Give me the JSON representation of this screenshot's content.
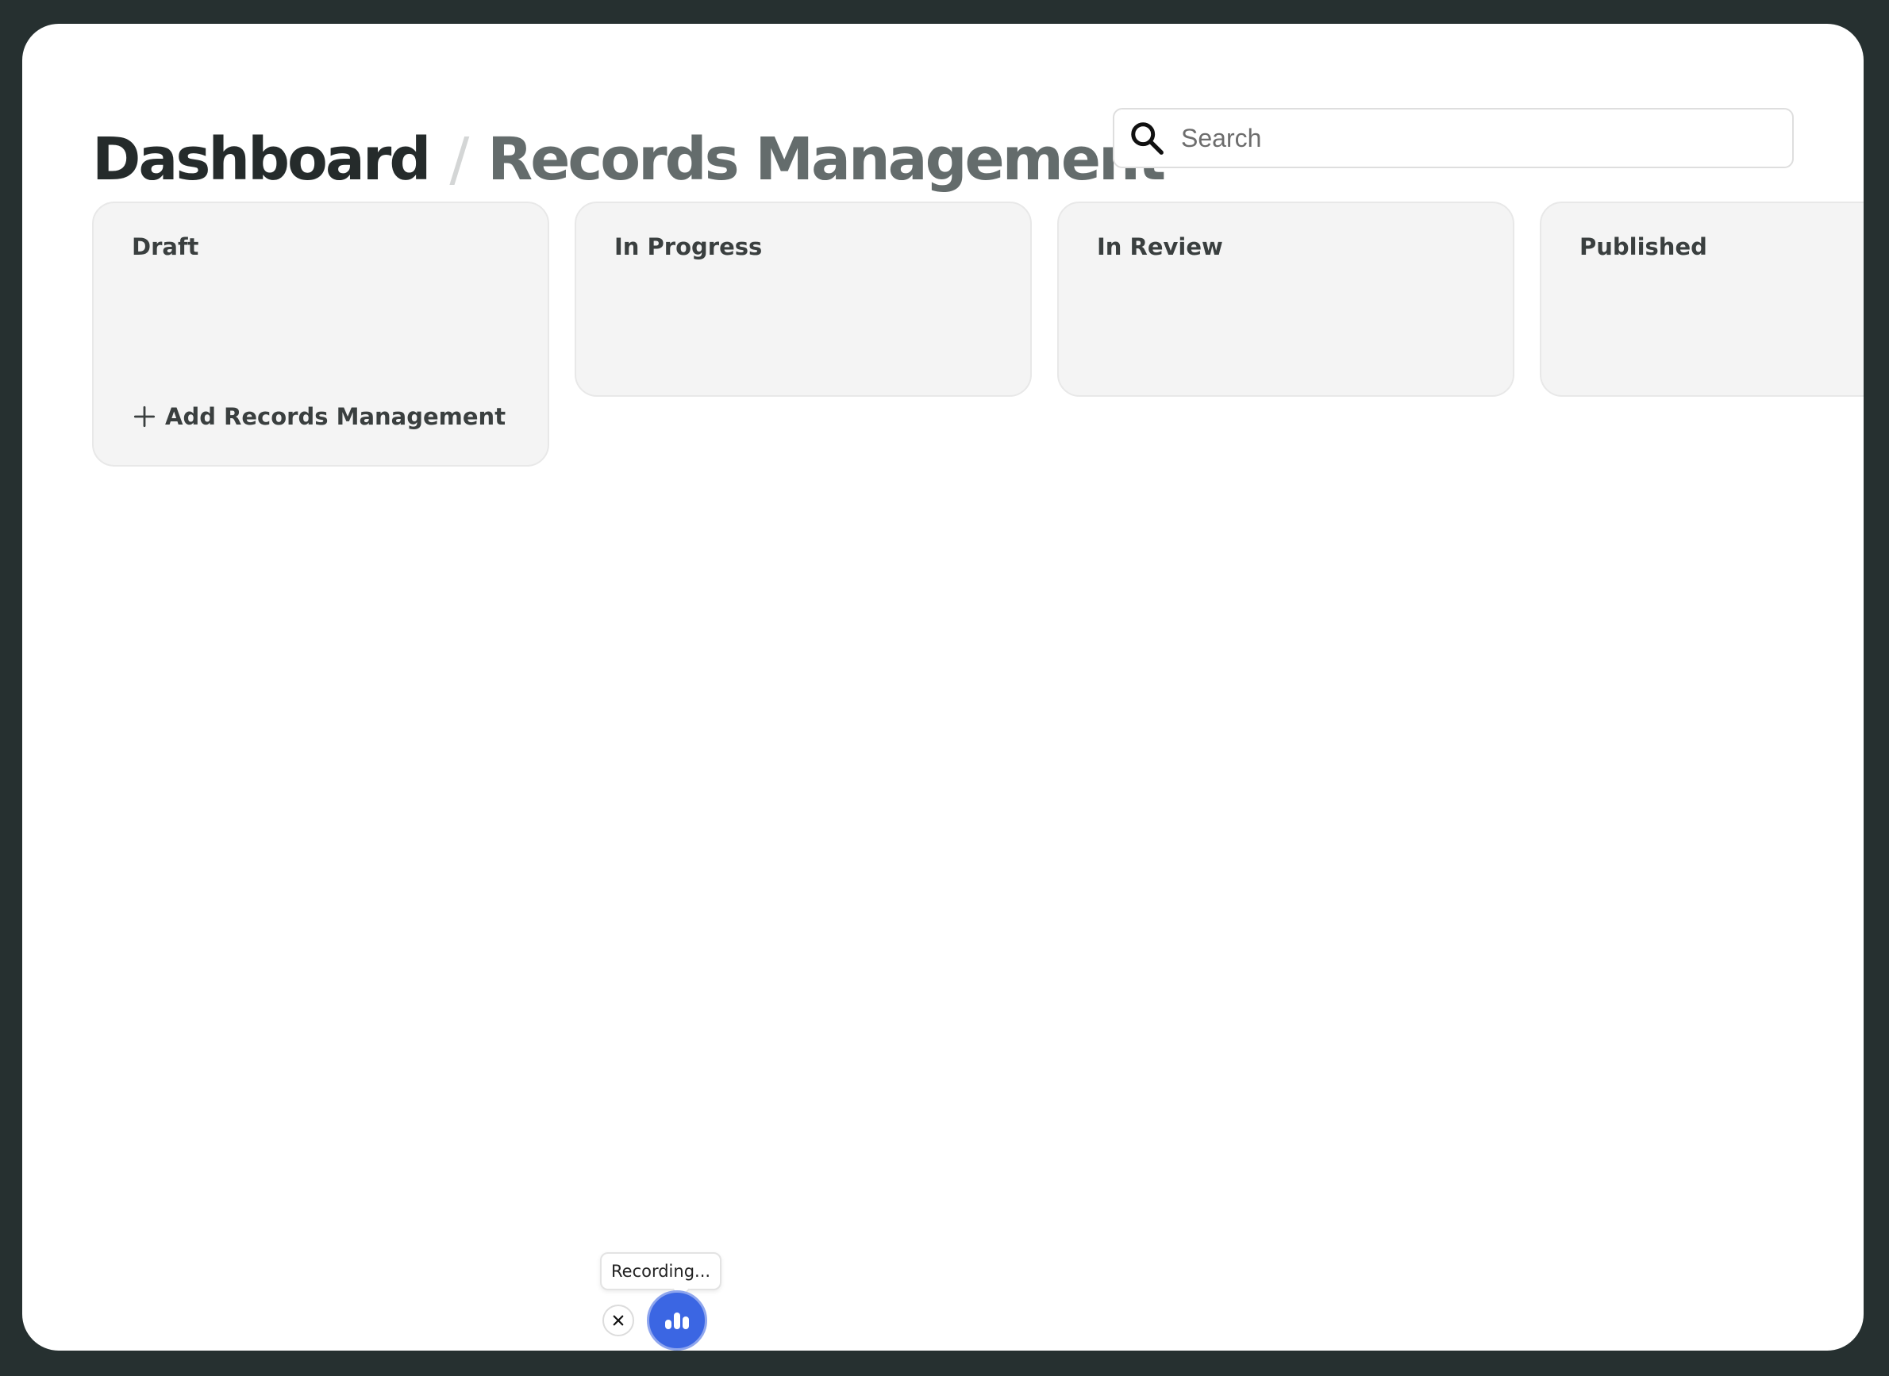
{
  "breadcrumb": {
    "root": "Dashboard",
    "separator": "/",
    "current": "Records Management"
  },
  "search": {
    "placeholder": "Search",
    "value": "",
    "icon": "search-icon"
  },
  "board": {
    "columns": [
      {
        "title": "Draft",
        "add_label": "Add Records Management"
      },
      {
        "title": "In Progress"
      },
      {
        "title": "In Review"
      },
      {
        "title": "Published"
      }
    ]
  },
  "recorder": {
    "tooltip": "Recording...",
    "close_icon": "close-icon",
    "main_icon": "audio-bars-icon"
  },
  "colors": {
    "background": "#263030",
    "surface": "#ffffff",
    "column_bg": "#f4f4f4",
    "title_dark": "#252b2b",
    "title_muted": "#646c6c",
    "accent": "#3b66e3"
  }
}
